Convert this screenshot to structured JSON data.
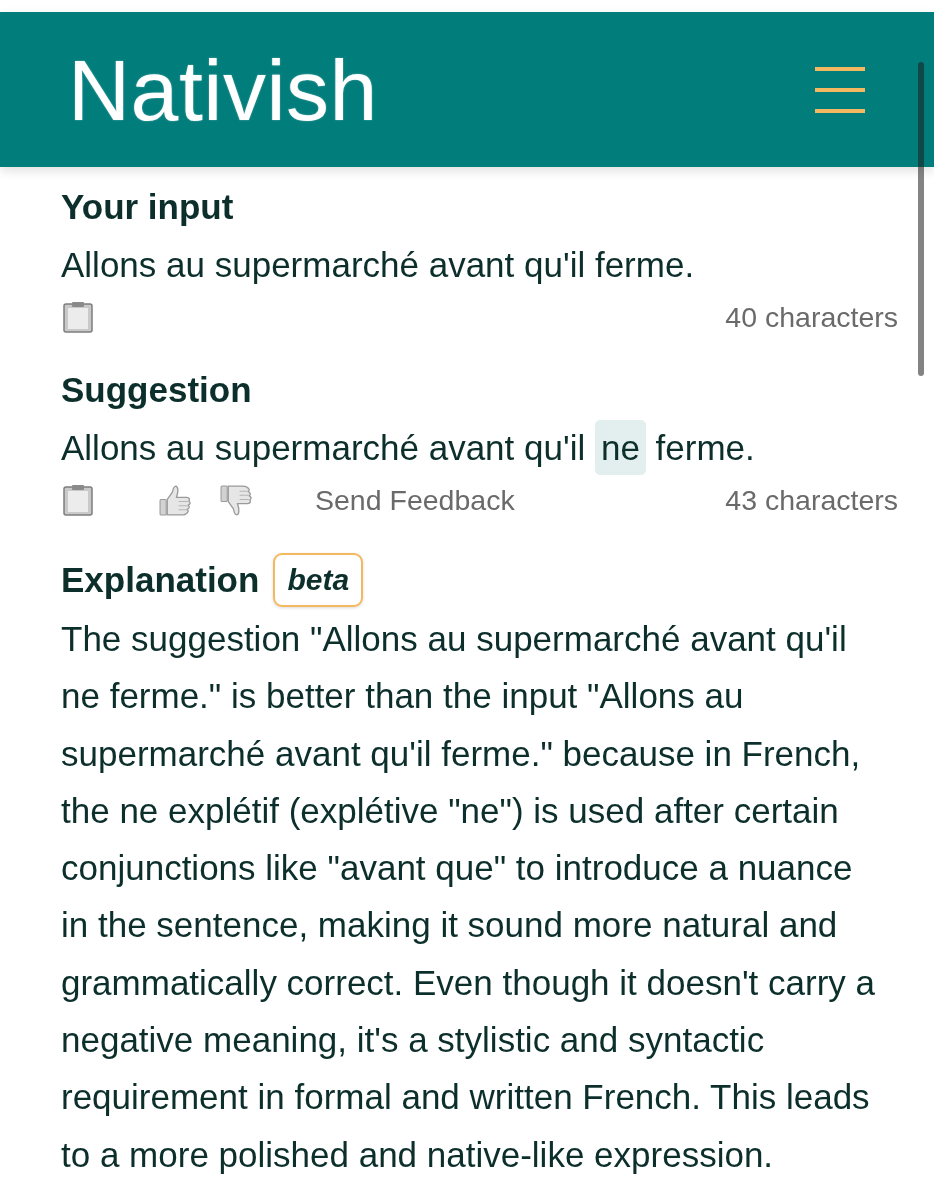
{
  "header": {
    "logo": "Nativish"
  },
  "input": {
    "title": "Your input",
    "text": "Allons au supermarché avant qu'il ferme.",
    "char_count": "40 characters"
  },
  "suggestion": {
    "title": "Suggestion",
    "segments": [
      {
        "text": "Allons au supermarché avant qu'il",
        "highlighted": false
      },
      {
        "text": "ne",
        "highlighted": true
      },
      {
        "text": "ferme.",
        "highlighted": false
      }
    ],
    "feedback_label": "Send Feedback",
    "char_count": "43 characters"
  },
  "explanation": {
    "title": "Explanation",
    "badge": "beta",
    "text": "The suggestion \"Allons au supermarché avant qu'il ne ferme.\" is better than the input \"Allons au supermarché avant qu'il ferme.\" because in French, the ne explétif (explétive \"ne\") is used after certain conjunctions like \"avant que\" to introduce a nuance in the sentence, making it sound more natural and grammatically correct. Even though it doesn't carry a negative meaning, it's a stylistic and syntactic requirement in formal and written French. This leads to a more polished and native-like expression."
  }
}
